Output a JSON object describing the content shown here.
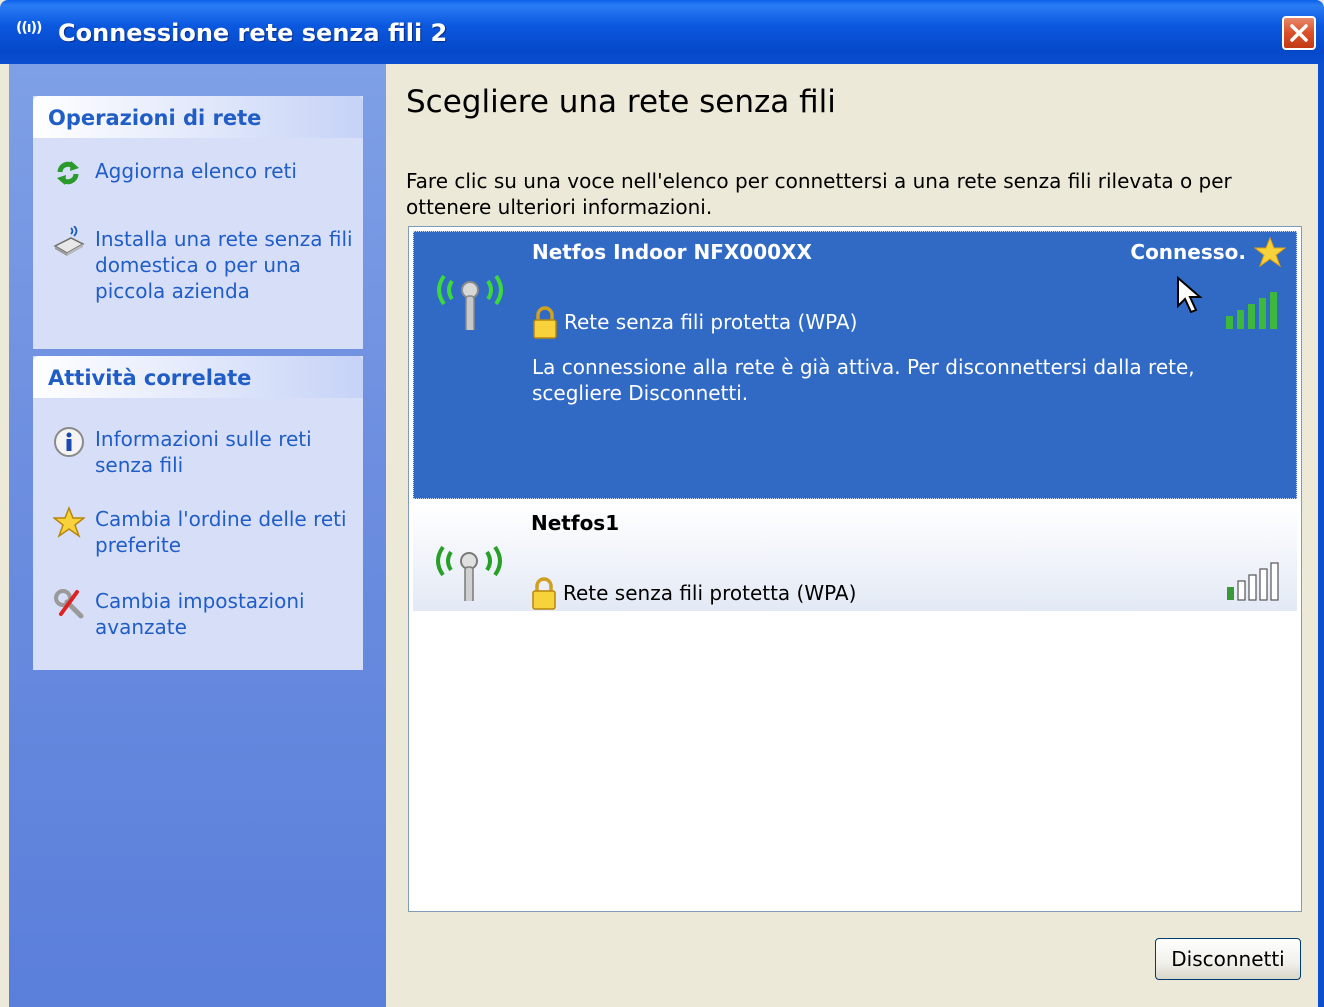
{
  "window": {
    "title": "Connessione rete senza fili 2",
    "title_icon": "((ı))"
  },
  "sidebar": {
    "network_tasks": {
      "header": "Operazioni di rete",
      "items": [
        {
          "label": "Aggiorna elenco reti",
          "icon": "refresh-icon"
        },
        {
          "label": "Installa una rete senza fili domestica o per una piccola azienda",
          "icon": "wireless-setup-icon"
        }
      ]
    },
    "related_tasks": {
      "header": "Attività correlate",
      "items": [
        {
          "label": "Informazioni sulle reti senza fili",
          "icon": "info-icon"
        },
        {
          "label": "Cambia l'ordine delle reti preferite",
          "icon": "star-icon"
        },
        {
          "label": "Cambia impostazioni avanzate",
          "icon": "tools-icon"
        }
      ]
    }
  },
  "main": {
    "heading": "Scegliere una rete senza fili",
    "intro": "Fare clic su una voce nell'elenco per connettersi a una rete senza fili rilevata o per ottenere ulteriori informazioni.",
    "networks": [
      {
        "name": "Netfos Indoor NFX000XX",
        "status": "Connesso.",
        "security": "Rete senza fili protetta (WPA)",
        "description": "La connessione alla rete è già attiva. Per disconnettersi dalla rete, scegliere Disconnetti.",
        "signal_bars": 5,
        "selected": true
      },
      {
        "name": "Netfos1",
        "status": "",
        "security": "Rete senza fili protetta (WPA)",
        "description": "",
        "signal_bars": 1,
        "selected": false
      }
    ],
    "disconnect_label": "Disconnetti"
  },
  "colors": {
    "titlebar": "#0b58df",
    "sidebar": "#6e8fe0",
    "selection": "#316ac5",
    "link": "#215dc6",
    "signal_on": "#3cb83c"
  }
}
